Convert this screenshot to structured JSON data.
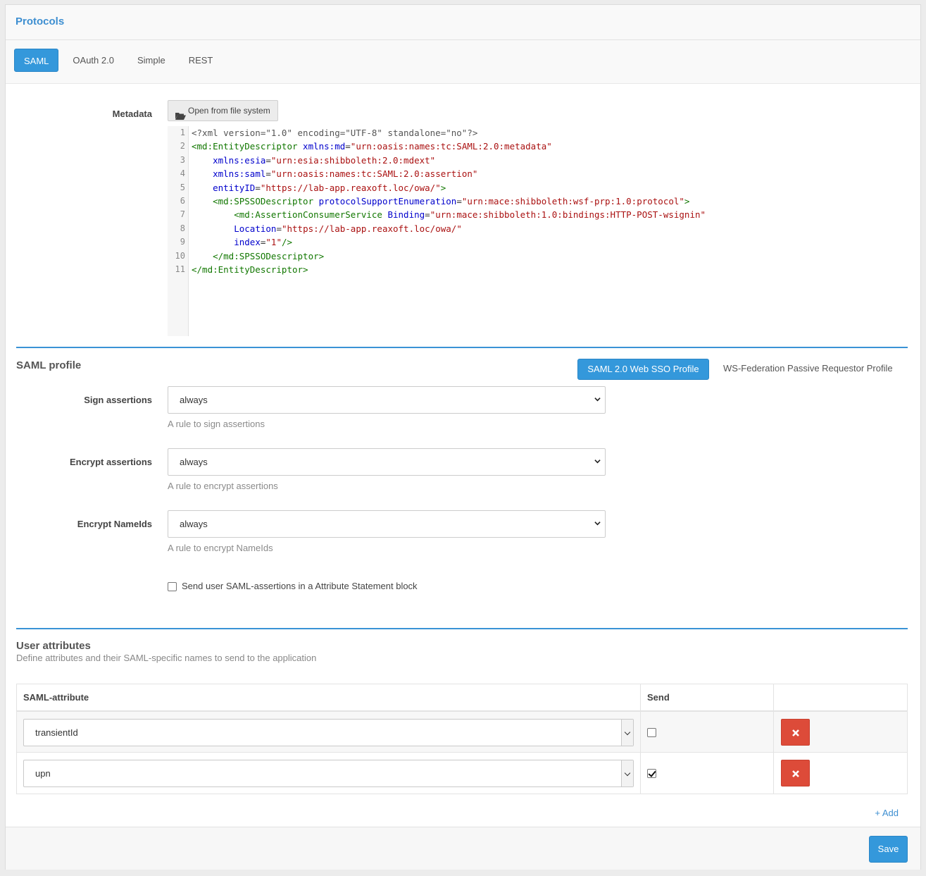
{
  "panel": {
    "title": "Protocols"
  },
  "tabs": [
    {
      "label": "SAML",
      "active": true
    },
    {
      "label": "OAuth 2.0",
      "active": false
    },
    {
      "label": "Simple",
      "active": false
    },
    {
      "label": "REST",
      "active": false
    }
  ],
  "metadata": {
    "label": "Metadata",
    "open_button": "Open from file system",
    "line_numbers": [
      "1",
      "2",
      "3",
      "4",
      "5",
      "6",
      "7",
      "8",
      "9",
      "10",
      "11"
    ]
  },
  "saml_profile": {
    "title": "SAML profile",
    "profile_buttons": [
      {
        "label": "SAML 2.0 Web SSO Profile",
        "active": true
      },
      {
        "label": "WS-Federation Passive Requestor Profile",
        "active": false
      }
    ],
    "sign": {
      "label": "Sign assertions",
      "value": "always",
      "help": "A rule to sign assertions"
    },
    "encrypt": {
      "label": "Encrypt assertions",
      "value": "always",
      "help": "A rule to encrypt assertions"
    },
    "encrypt_nameids": {
      "label": "Encrypt NameIds",
      "value": "always",
      "help": "A rule to encrypt NameIds"
    },
    "attr_statement": {
      "label": "Send user SAML-assertions in a Attribute Statement block",
      "checked": false
    }
  },
  "user_attributes": {
    "title": "User attributes",
    "description": "Define attributes and their SAML-specific names to send to the application",
    "columns": {
      "attribute": "SAML-attribute",
      "send": "Send"
    },
    "rows": [
      {
        "attribute": "transientId",
        "send": false
      },
      {
        "attribute": "upn",
        "send": true
      }
    ],
    "add_label": "+ Add"
  },
  "footer": {
    "save_label": "Save"
  },
  "colors": {
    "accent": "#3498db",
    "danger": "#dd4b39",
    "title": "#3e8fd1"
  }
}
